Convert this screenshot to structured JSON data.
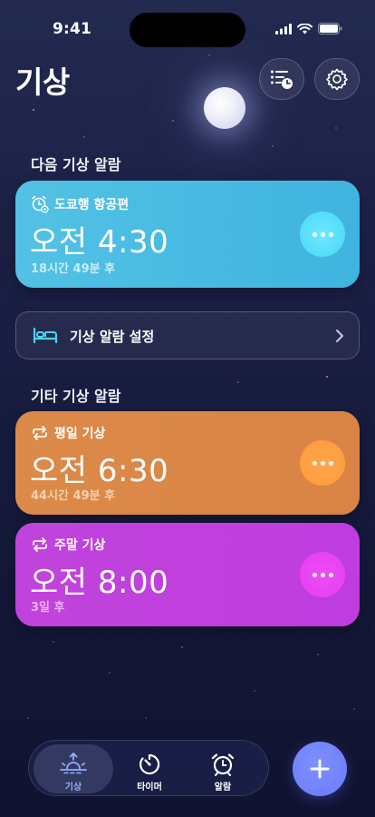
{
  "status_bar": {
    "time": "9:41"
  },
  "header": {
    "title": "기상"
  },
  "next_section": {
    "label": "다음 기상 알람",
    "alarm": {
      "name": "도쿄행 항공편",
      "time": "오전 4:30",
      "remaining": "18시간 49분 후"
    }
  },
  "settings_row": {
    "label": "기상 알람 설정"
  },
  "other_section": {
    "label": "기타 기상 알람",
    "alarms": [
      {
        "name": "평일 기상",
        "time": "오전 6:30",
        "remaining": "44시간 49분 후"
      },
      {
        "name": "주말 기상",
        "time": "오전 8:00",
        "remaining": "3일 후"
      }
    ]
  },
  "tab_bar": {
    "tabs": [
      {
        "label": "기상",
        "icon": "sunrise-icon",
        "active": true
      },
      {
        "label": "타이머",
        "icon": "timer-icon",
        "active": false
      },
      {
        "label": "알람",
        "icon": "alarm-clock-icon",
        "active": false
      }
    ]
  },
  "colors": {
    "background": "#1b2046",
    "next_card": "#48bae2",
    "weekday_card": "#da8747",
    "weekend_card": "#c040dd",
    "accent": "#6a7af8",
    "active_tab_text": "#8fb0ff"
  }
}
